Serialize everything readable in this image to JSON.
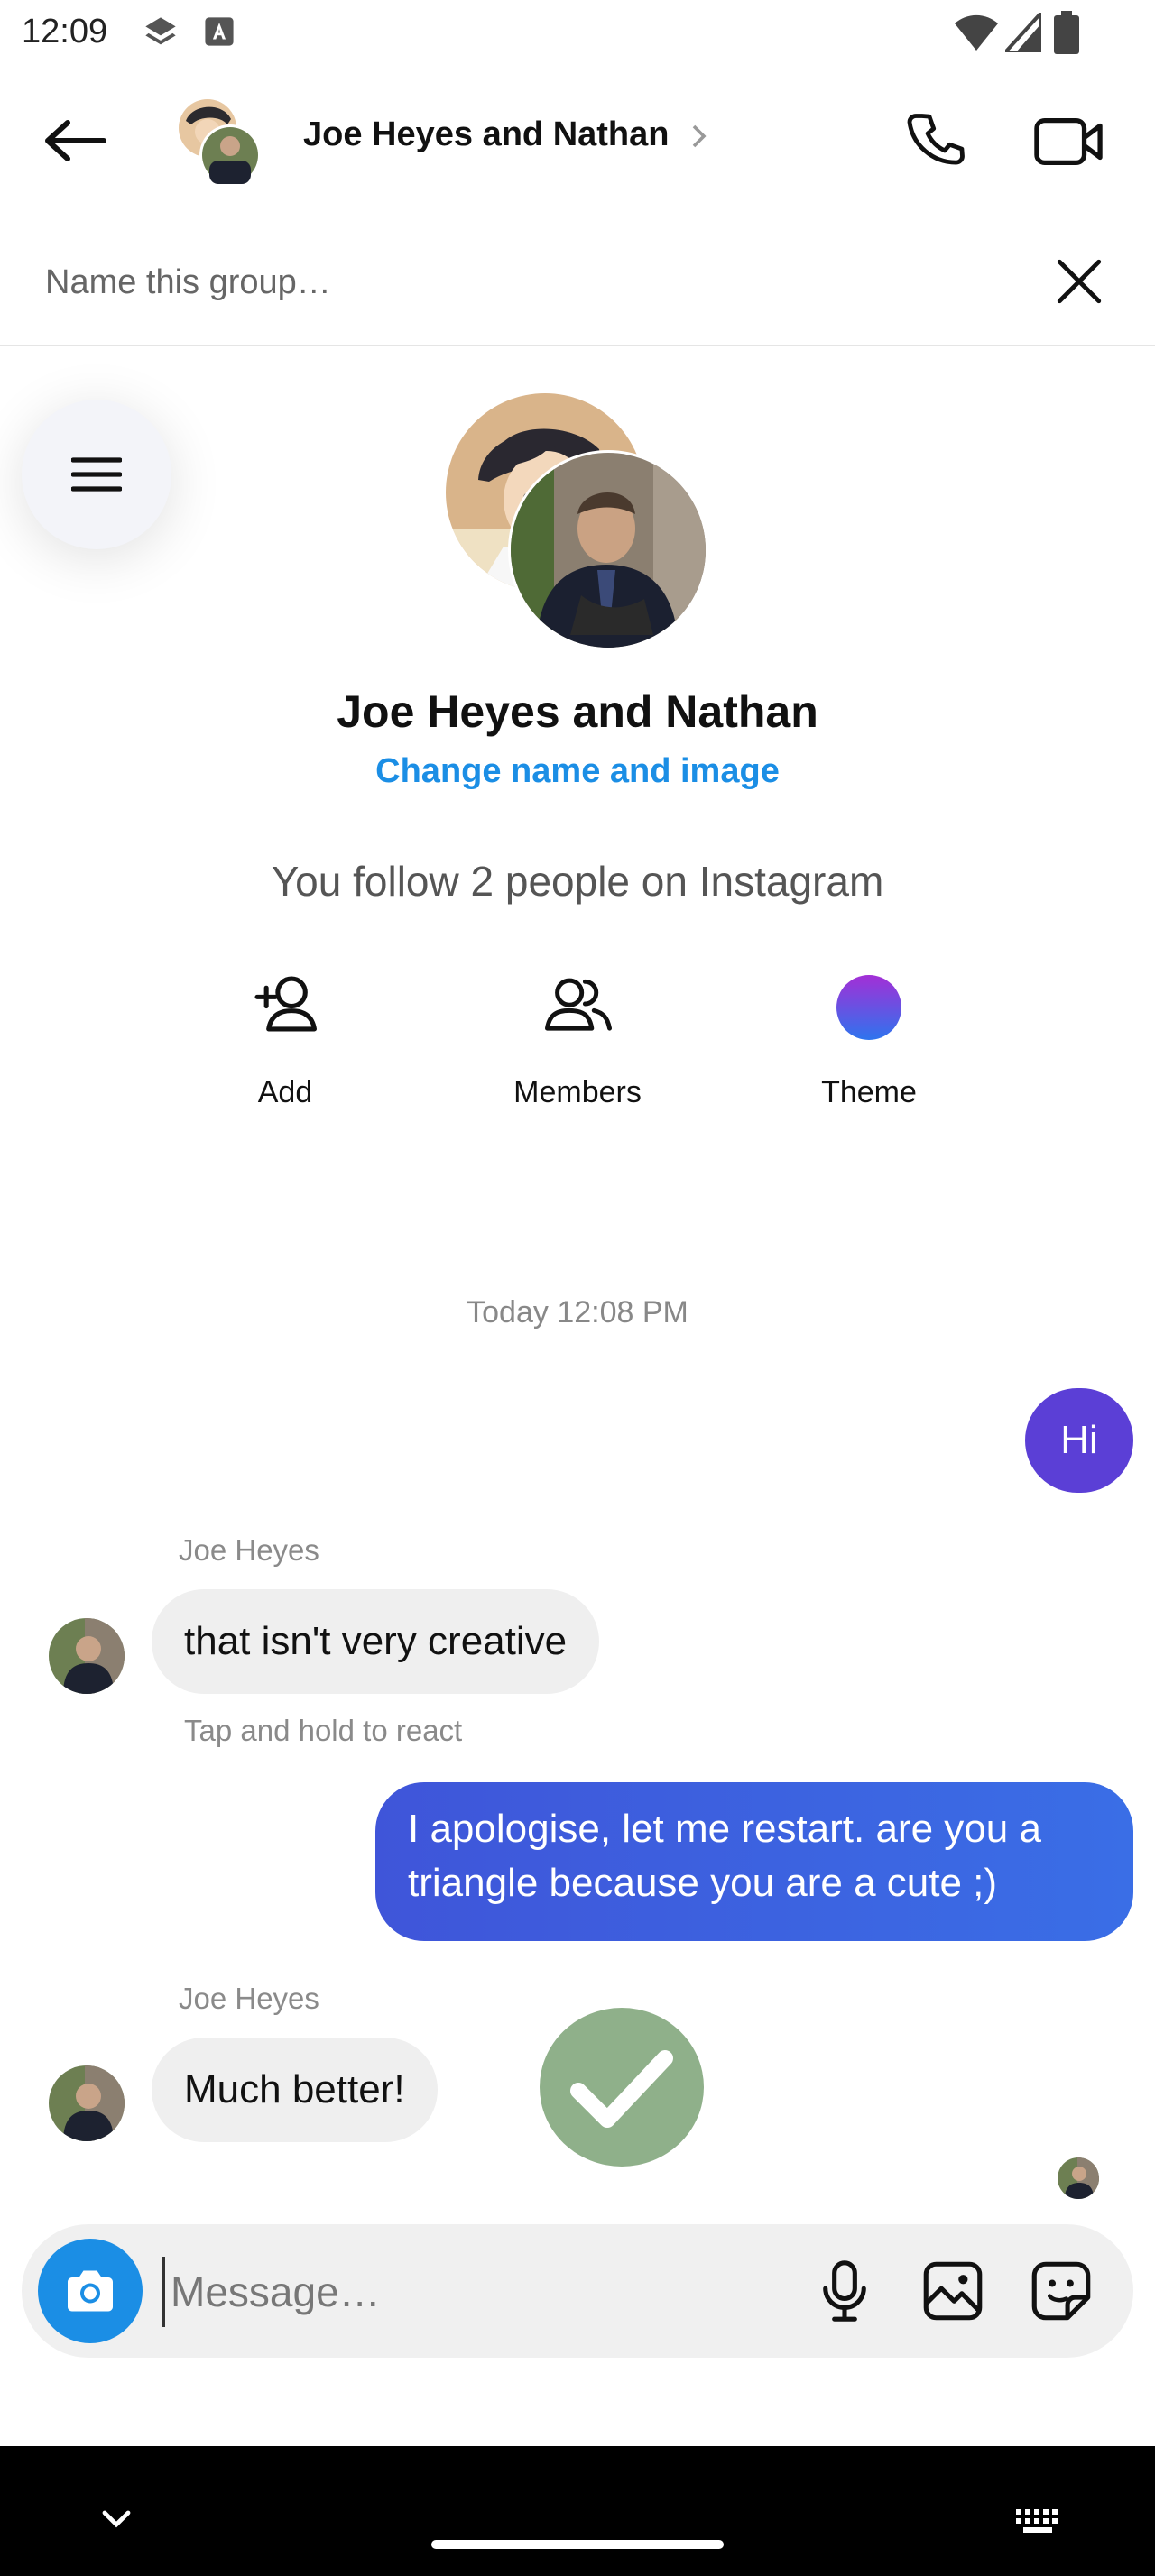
{
  "status_bar": {
    "time": "12:09"
  },
  "header": {
    "title": "Joe Heyes and Nathan",
    "name_placeholder": "Name this group…"
  },
  "group": {
    "name": "Joe Heyes and Nathan",
    "change_link": "Change name and image",
    "follow_text": "You follow 2 people on Instagram"
  },
  "actions": [
    {
      "label": "Add",
      "icon": "add-person-icon"
    },
    {
      "label": "Members",
      "icon": "members-icon"
    },
    {
      "label": "Theme",
      "icon": "theme-swatch-icon"
    }
  ],
  "chat": {
    "timestamp": "Today 12:08 PM",
    "messages": [
      {
        "from": "me",
        "text": "Hi"
      },
      {
        "from": "Joe Heyes",
        "sender_label": "Joe Heyes",
        "text": "that isn't very creative"
      },
      {
        "hint": "Tap and hold to react"
      },
      {
        "from": "me",
        "text_line1": "I apologise, let me restart. are you a",
        "text_line2": "triangle because you are a cute ;)"
      },
      {
        "from": "Joe Heyes",
        "sender_label": "Joe Heyes",
        "text": "Much better!"
      }
    ]
  },
  "composer": {
    "placeholder": "Message…"
  },
  "colors": {
    "accent_blue": "#1b8ee5",
    "outgoing_purple": "#5b3fd6",
    "outgoing_blue": "#3a6ee6",
    "incoming_bubble": "#efefef",
    "sticker_green": "#8fb08a"
  }
}
